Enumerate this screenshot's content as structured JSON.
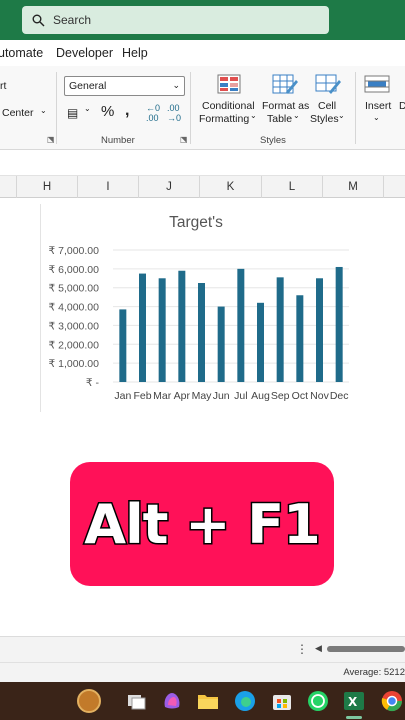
{
  "search": {
    "placeholder": "Search"
  },
  "menu": {
    "items": [
      "utomate",
      "Developer",
      "Help"
    ]
  },
  "ribbon": {
    "alignment": {
      "wrap_partial": "rt",
      "merge_partial": "Center"
    },
    "number": {
      "format_value": "General",
      "label": "Number"
    },
    "styles": {
      "conditional": [
        "Conditional",
        "Formatting"
      ],
      "format_as_table": [
        "Format as",
        "Table"
      ],
      "cell_styles": [
        "Cell",
        "Styles"
      ],
      "label": "Styles"
    },
    "cells": {
      "insert": "Insert",
      "partial": "D"
    }
  },
  "columns": [
    "H",
    "I",
    "J",
    "K",
    "L",
    "M"
  ],
  "chart_data": {
    "type": "bar",
    "title": "Target's",
    "categories": [
      "Jan",
      "Feb",
      "Mar",
      "Apr",
      "May",
      "Jun",
      "Jul",
      "Aug",
      "Sep",
      "Oct",
      "Nov",
      "Dec"
    ],
    "values": [
      3850,
      5750,
      5500,
      5900,
      5250,
      4000,
      6000,
      4200,
      5550,
      4600,
      5500,
      6100
    ],
    "y_tick_labels": [
      "₹ 7,000.00",
      "₹ 6,000.00",
      "₹ 5,000.00",
      "₹ 4,000.00",
      "₹ 3,000.00",
      "₹ 2,000.00",
      "₹ 1,000.00",
      "₹ -"
    ],
    "ylim": [
      0,
      7000
    ],
    "grid": true,
    "bar_color": "#1f6b8a"
  },
  "overlay": {
    "text": "Alt + F1",
    "color": "#ff1158"
  },
  "status": {
    "average": "Average: 5212"
  },
  "colors": {
    "excel_green": "#1e7a47",
    "taskbar": "#3a2418"
  }
}
